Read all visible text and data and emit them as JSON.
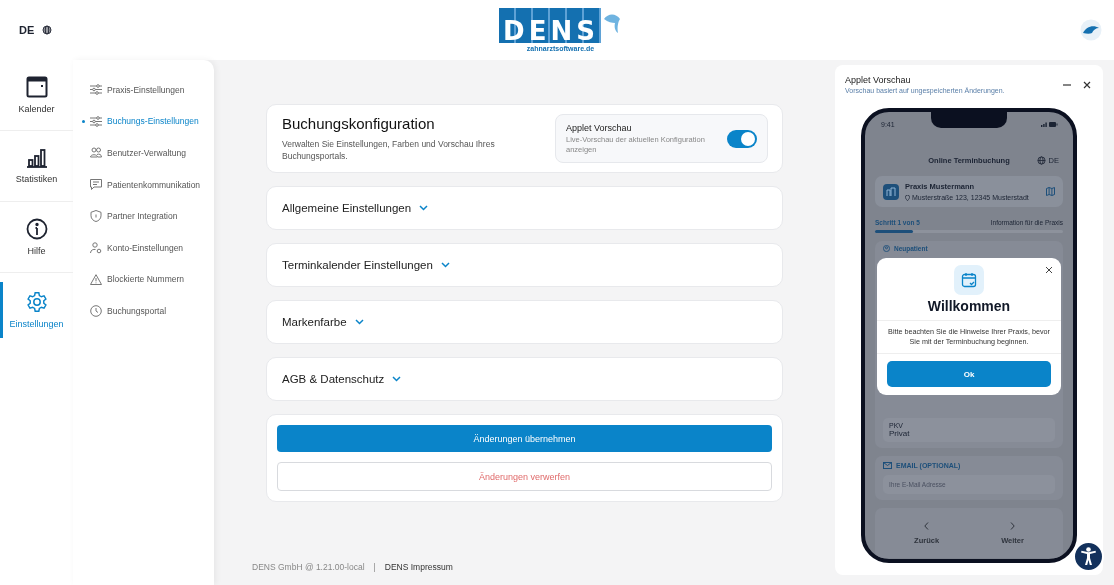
{
  "header": {
    "language": "DE",
    "logo": {
      "wordmark": "DENS",
      "domain": "zahnarztsoftware.de"
    }
  },
  "nav_rail": [
    {
      "label": "Kalender",
      "selected": false
    },
    {
      "label": "Statistiken",
      "selected": false
    },
    {
      "label": "Hilfe",
      "selected": false
    },
    {
      "label": "Einstellungen",
      "selected": true
    }
  ],
  "submenu": [
    {
      "label": "Praxis-Einstellungen",
      "selected": false
    },
    {
      "label": "Buchungs-Einstellungen",
      "selected": true
    },
    {
      "label": "Benutzer-Verwaltung",
      "selected": false
    },
    {
      "label": "Patientenkommunikation",
      "selected": false
    },
    {
      "label": "Partner Integration",
      "selected": false
    },
    {
      "label": "Konto-Einstellungen",
      "selected": false
    },
    {
      "label": "Blockierte Nummern",
      "selected": false
    },
    {
      "label": "Buchungsportal",
      "selected": false
    }
  ],
  "config_card": {
    "title": "Buchungskonfiguration",
    "description": "Verwalten Sie Einstellungen, Farben und Vorschau Ihres Buchungsportals.",
    "applet_toggle": {
      "label": "Applet Vorschau",
      "description": "Live-Vorschau der aktuellen Konfiguration anzeigen",
      "on": true
    }
  },
  "sections": [
    {
      "title": "Allgemeine Einstellungen",
      "expanded": false
    },
    {
      "title": "Terminkalender Einstellungen",
      "expanded": false
    },
    {
      "title": "Markenfarbe",
      "expanded": false
    },
    {
      "title": "AGB & Datenschutz",
      "expanded": false
    }
  ],
  "actions": {
    "apply": "Änderungen übernehmen",
    "discard": "Änderungen verwerfen"
  },
  "footer": {
    "version": "DENS GmbH @ 1.21.00-local",
    "separator": "|",
    "link": "DENS Impressum"
  },
  "preview": {
    "title": "Applet Vorschau",
    "subtitle": "Vorschau basiert auf ungespeicherten Änderungen.",
    "phone": {
      "time": "9:41",
      "title": "Online Terminbuchung",
      "language": "DE",
      "practice_name": "Praxis Mustermann",
      "practice_address": "Musterstraße 123, 12345 Musterstadt",
      "step": "Schritt 1 von 5",
      "step_info": "Information für die Praxis",
      "progress": {
        "level": 0.2
      },
      "patient_type": "Neupatient",
      "insurance_label": "PKV",
      "insurance_value": "Privat",
      "email_label": "EMAIL (OPTIONAL)",
      "email_placeholder": "Ihre E-Mail Adresse",
      "back": "Zurück",
      "next": "Weiter",
      "dialog": {
        "title": "Willkommen",
        "message": "Bitte beachten Sie die Hinweise Ihrer Praxis, bevor Sie mit der Terminbuchung beginnen.",
        "button": "Ok"
      }
    }
  }
}
